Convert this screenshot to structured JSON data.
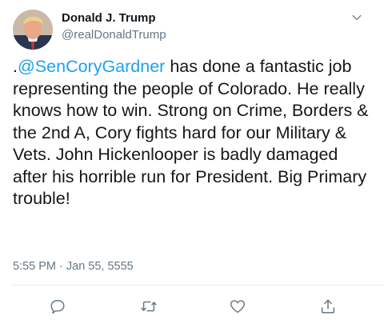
{
  "tweet": {
    "author_name": "Donald J. Trump",
    "author_handle": "@realDonaldTrump",
    "text_prefix": ".",
    "mention": "@SenCoryGardner",
    "text_body": " has done a fantastic job representing the people of Colorado. He really knows how to win. Strong on Crime, Borders & the 2nd A, Cory fights hard for our Military & Vets. John Hickenlooper is badly damaged after his horrible run for President. Big Primary trouble!",
    "timestamp": "5:55 PM · Jan 55, 5555"
  },
  "colors": {
    "text": "#14171a",
    "secondary": "#657786",
    "link": "#1da1f2",
    "divider": "#e6ecf0"
  },
  "icons": {
    "menu": "chevron-down-icon",
    "reply": "reply-icon",
    "retweet": "retweet-icon",
    "like": "heart-icon",
    "share": "share-icon"
  }
}
